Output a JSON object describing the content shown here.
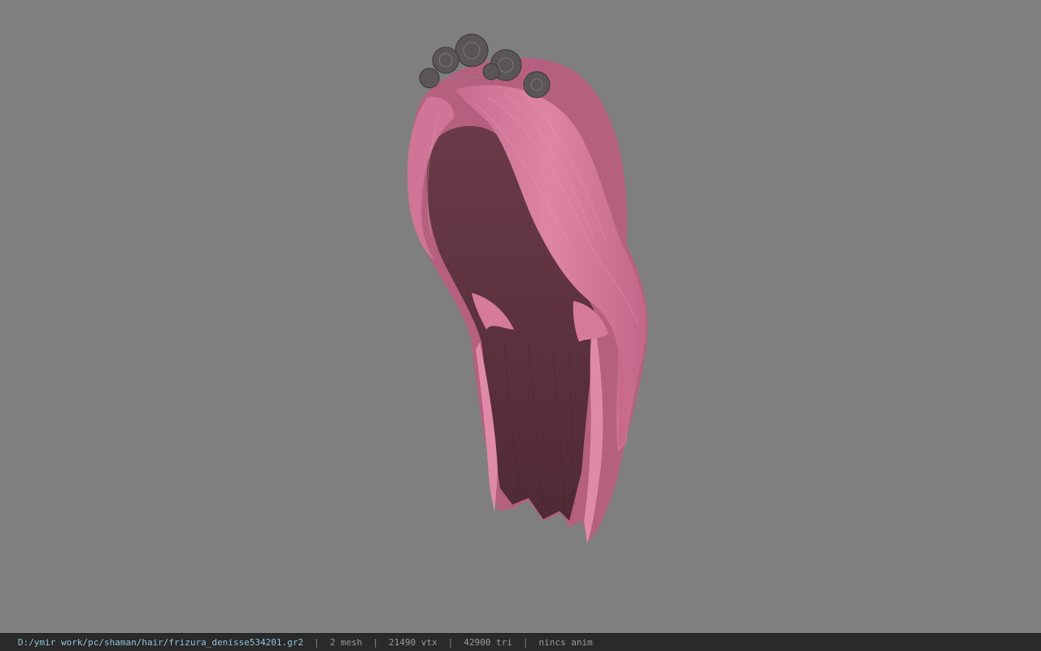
{
  "viewport": {
    "background": "#7f7f7f",
    "model_colors": {
      "hair_light": "#d77a9c",
      "hair_mid": "#b85f80",
      "hair_dark": "#5e3340",
      "flower": "#5a5657"
    }
  },
  "status_bar": {
    "file_path": "D:/ymir work/pc/shaman/hair/frizura_denisse534201.gr2",
    "separator": "|",
    "mesh_count": "2 mesh",
    "vertex_count": "21490 vtx",
    "triangle_count": "42900 tri",
    "anim_status": "nincs anim"
  }
}
